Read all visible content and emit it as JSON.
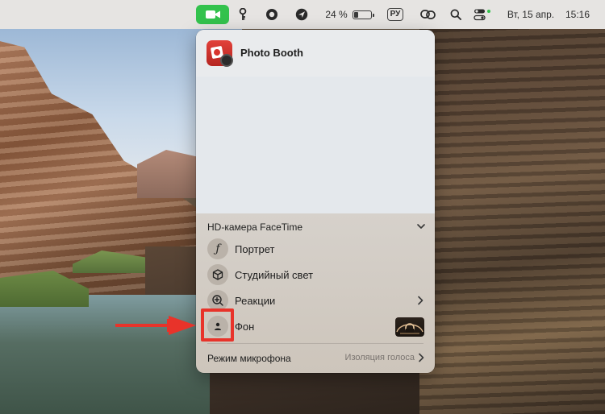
{
  "menubar": {
    "camera_icon": "video-camera-icon",
    "battery_percent": "24 %",
    "battery_level": 0.24,
    "input_source": "РУ",
    "date": "Вт, 15 апр.",
    "time": "15:16",
    "camera_pill_color": "#33c24d"
  },
  "panel": {
    "app": {
      "name": "Photo Booth",
      "icon": "photo-booth-icon"
    },
    "camera_section": {
      "title": "HD-камера FaceTime",
      "icon": "chevron-down-icon"
    },
    "effects": [
      {
        "label": "Портрет",
        "icon": "portrait-f-icon"
      },
      {
        "label": "Студийный свет",
        "icon": "cube-icon"
      },
      {
        "label": "Реакции",
        "icon": "reactions-plus-icon",
        "has_chevron": true
      },
      {
        "label": "Фон",
        "icon": "person-background-icon",
        "has_thumbnail": true
      }
    ],
    "mic_mode": {
      "label": "Режим микрофона",
      "value": "Изоляция голоса"
    }
  },
  "annotation": {
    "highlight_color": "#e8332a",
    "target": "Фон"
  }
}
